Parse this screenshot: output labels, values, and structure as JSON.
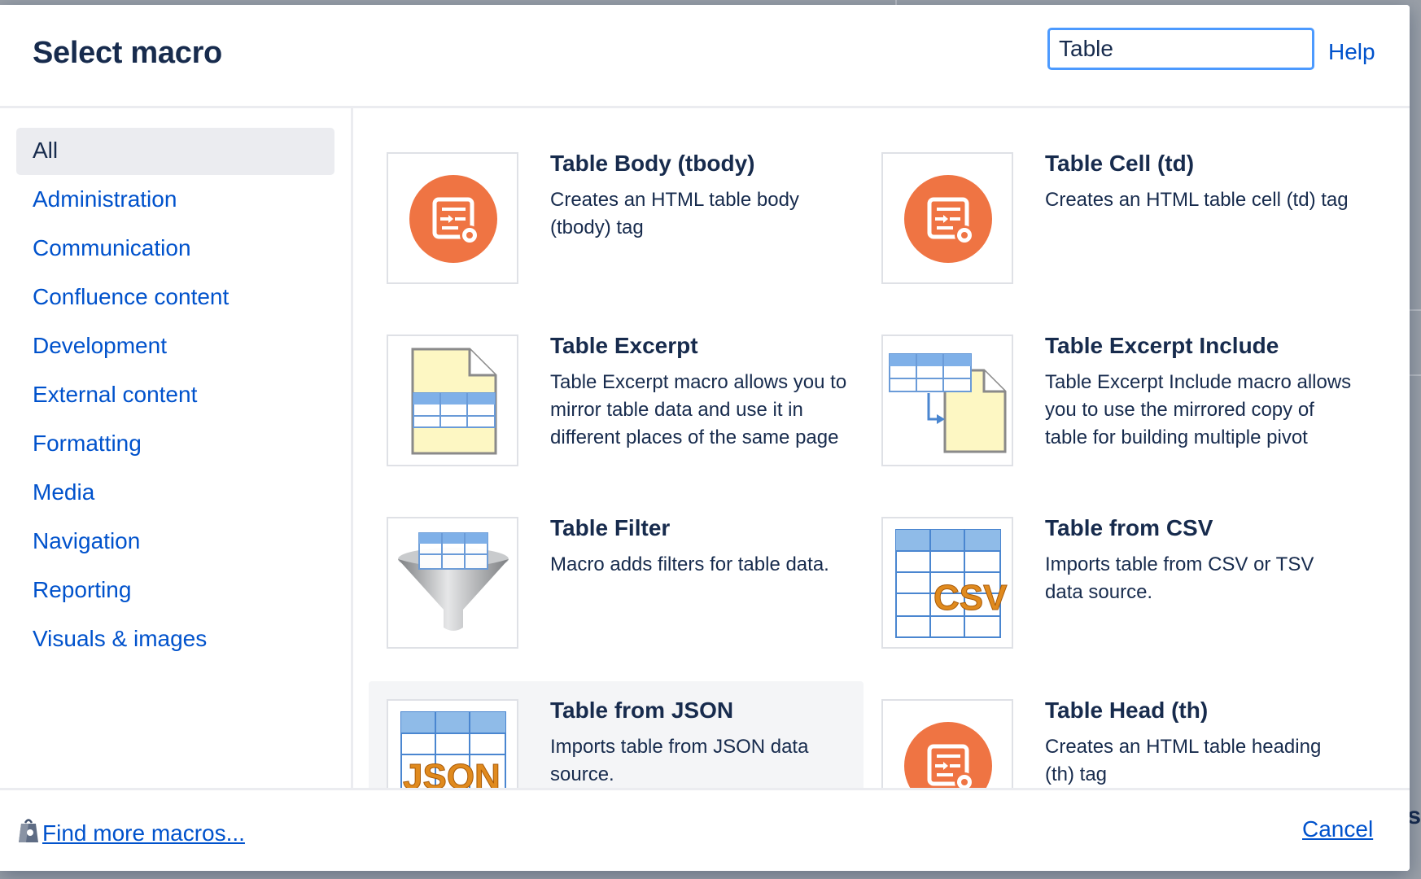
{
  "dialog": {
    "title": "Select macro",
    "search": {
      "value": "Table",
      "placeholder": ""
    },
    "help_label": "Help"
  },
  "sidebar": {
    "categories": [
      {
        "label": "All",
        "selected": true
      },
      {
        "label": "Administration"
      },
      {
        "label": "Communication"
      },
      {
        "label": "Confluence content"
      },
      {
        "label": "Development"
      },
      {
        "label": "External content"
      },
      {
        "label": "Formatting"
      },
      {
        "label": "Media"
      },
      {
        "label": "Navigation"
      },
      {
        "label": "Reporting"
      },
      {
        "label": "Visuals & images"
      }
    ]
  },
  "macros": [
    {
      "name": "Table Body (tbody)",
      "description": "Creates an HTML table body (tbody) tag",
      "icon": "html-tag-gear-icon"
    },
    {
      "name": "Table Cell (td)",
      "description": "Creates an HTML table cell (td) tag",
      "icon": "html-tag-gear-icon"
    },
    {
      "name": "Table Excerpt",
      "description": "Table Excerpt macro allows you to mirror table data and use it in different places of the same page for building multiple pivot tables",
      "icon": "table-excerpt-icon"
    },
    {
      "name": "Table Excerpt Include",
      "description": "Table Excerpt Include macro allows you to use the mirrored copy of table for building multiple pivot tables and generating",
      "icon": "table-excerpt-include-icon"
    },
    {
      "name": "Table Filter",
      "description": "Macro adds filters for table data.",
      "icon": "table-filter-funnel-icon"
    },
    {
      "name": "Table from CSV",
      "description": "Imports table from CSV or TSV data source.",
      "icon": "table-csv-icon",
      "icon_text": "CSV"
    },
    {
      "name": "Table from JSON",
      "description": "Imports table from JSON data source.",
      "icon": "table-json-icon",
      "icon_text": "JSON"
    },
    {
      "name": "Table Head (th)",
      "description": "Creates an HTML table heading (th) tag",
      "icon": "html-tag-gear-icon"
    }
  ],
  "footer": {
    "find_more_label": "Find more macros...",
    "find_more_icon": "marketplace-bag-icon",
    "cancel_label": "Cancel"
  },
  "background": {
    "partial_char": "s"
  },
  "colors": {
    "link": "#0052cc",
    "text": "#172b4d",
    "accent_orange": "#ef7443",
    "focus_border": "#4c9aff"
  }
}
